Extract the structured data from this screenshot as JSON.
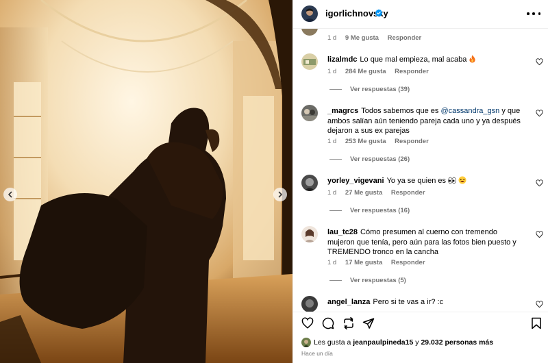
{
  "post": {
    "author": "igorlichnovsky",
    "verified": true,
    "likes_prefix": "Les gusta a",
    "likes_user": "jeanpaulpineda15",
    "likes_connector": "y",
    "likes_count": "29.032 personas más",
    "time_ago": "Hace un día"
  },
  "top_comment_meta": {
    "time": "1 d",
    "likes": "9 Me gusta",
    "reply": "Responder"
  },
  "comments": [
    {
      "user": "lizalmdc",
      "text": "Lo que mal empieza, mal acaba",
      "emoji": "fire",
      "time": "1 d",
      "likes": "284 Me gusta",
      "reply": "Responder",
      "view_replies": "Ver respuestas (39)"
    },
    {
      "user": "_magrcs",
      "text_before": "Todos sabemos que es",
      "mention": "@cassandra_gsn",
      "text_after": "y que ambos salían aún teniendo pareja cada uno y ya después dejaron a sus ex parejas",
      "time": "1 d",
      "likes": "253 Me gusta",
      "reply": "Responder",
      "view_replies": "Ver respuestas (26)"
    },
    {
      "user": "yorley_vigevani",
      "text": "Yo ya se quien es",
      "emoji": "eyes, laughing",
      "time": "1 d",
      "likes": "27 Me gusta",
      "reply": "Responder",
      "view_replies": "Ver respuestas (16)"
    },
    {
      "user": "lau_tc28",
      "text": "Cómo presumen al cuerno con tremendo mujeron que tenía, pero aún para las fotos bien puesto y TREMENDO tronco en la cancha",
      "time": "1 d",
      "likes": "17 Me gusta",
      "reply": "Responder",
      "view_replies": "Ver respuestas (5)"
    },
    {
      "user": "angel_lanza",
      "text": "Pero si te vas a ir? :c"
    }
  ],
  "icons": {
    "prev": "chevron-left-icon",
    "next": "chevron-right-icon",
    "more": "more-options-icon",
    "like": "heart-icon",
    "comment": "comment-icon",
    "share": "share-icon",
    "save": "bookmark-icon",
    "verified": "verified-badge-icon"
  },
  "colors": {
    "verified": "#0095f6",
    "mention": "#00376b",
    "meta": "#737373"
  }
}
